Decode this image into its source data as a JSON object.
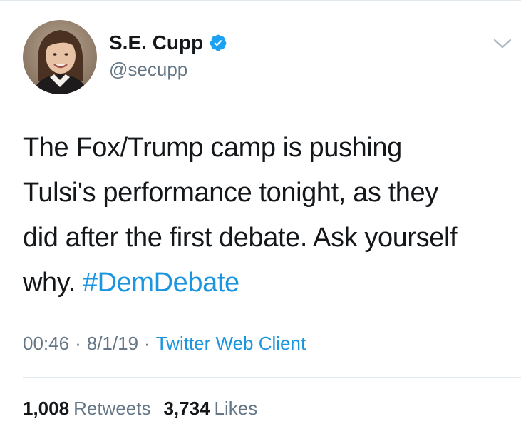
{
  "tweet": {
    "author": {
      "display_name": "S.E. Cupp",
      "handle": "@secupp",
      "verified": true
    },
    "text_lines": [
      "The Fox/Trump camp is pushing",
      "Tulsi's performance tonight, as they",
      "did after the first debate. Ask yourself",
      "why. "
    ],
    "hashtag": "#DemDebate",
    "meta": {
      "time": "00:46",
      "separator": "·",
      "date": "8/1/19",
      "client": "Twitter Web Client"
    },
    "stats": {
      "retweets_count": "1,008",
      "retweets_label": "Retweets",
      "likes_count": "3,734",
      "likes_label": "Likes"
    }
  },
  "icons": {
    "verified": "verified-badge-icon",
    "more": "chevron-down-icon"
  },
  "colors": {
    "link": "#1b95e0",
    "secondary_text": "#657786",
    "primary_text": "#14171a",
    "divider": "#e1e8ed",
    "verified": "#1da1f2"
  }
}
